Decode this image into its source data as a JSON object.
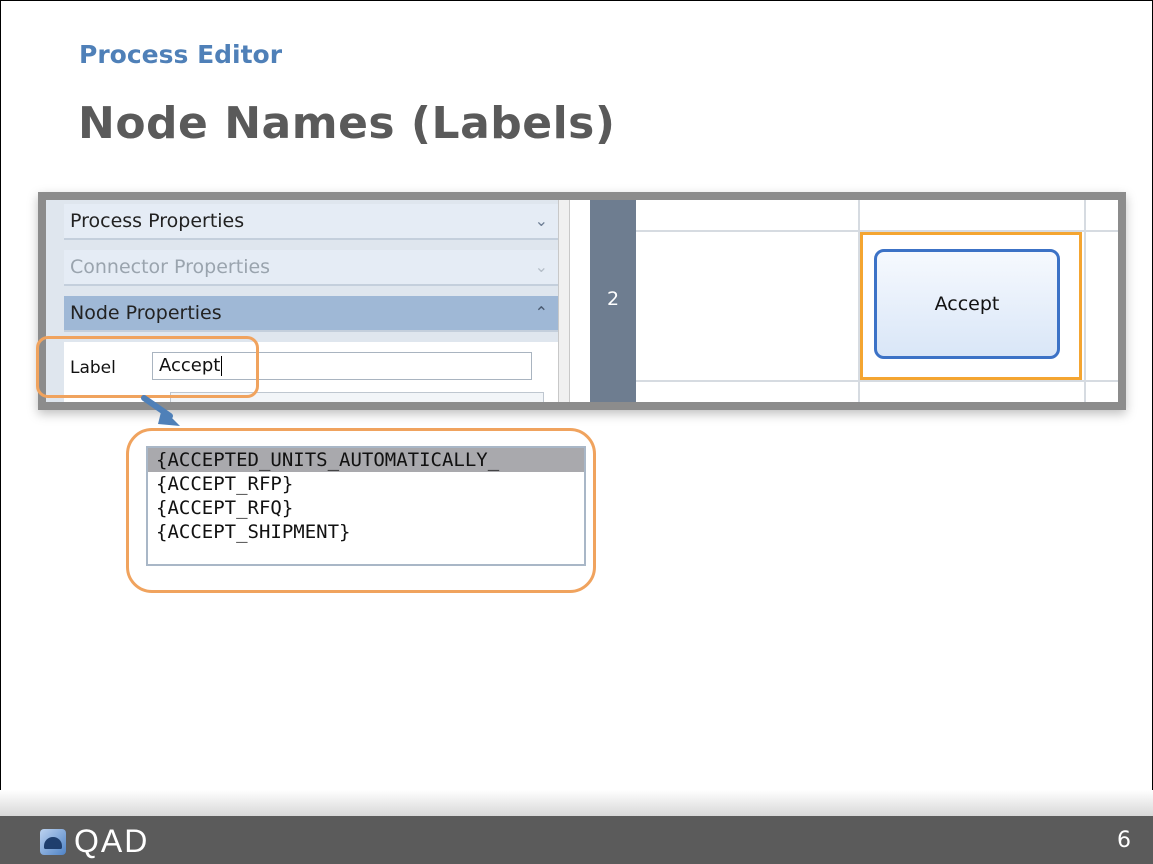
{
  "slide": {
    "subtitle": "Process Editor",
    "title": "Node Names (Labels)",
    "page_number": "6"
  },
  "panel": {
    "sections": [
      {
        "label": "Process Properties",
        "state": "collapsed",
        "icon": "chevron-down-icon"
      },
      {
        "label": "Connector Properties",
        "state": "disabled",
        "icon": "chevron-down-icon"
      },
      {
        "label": "Node Properties",
        "state": "expanded",
        "icon": "chevron-up-icon"
      }
    ],
    "label_field": {
      "label": "Label",
      "value": "Accept"
    }
  },
  "canvas": {
    "row_number": "2",
    "node_label": "Accept",
    "selection_color": "#f4a531",
    "node_border_color": "#3c72c6"
  },
  "autocomplete": {
    "options": [
      "{ACCEPTED_UNITS_AUTOMATICALLY_",
      "{ACCEPT_RFP}",
      "{ACCEPT_RFQ}",
      "{ACCEPT_SHIPMENT}"
    ],
    "selected_index": 0
  },
  "footer": {
    "logo_text": "QAD",
    "logo_icon": "qad-logo-icon"
  },
  "colors": {
    "accent": "#4f80b8",
    "callout": "#f0a35e",
    "footer": "#5b5b5b"
  }
}
